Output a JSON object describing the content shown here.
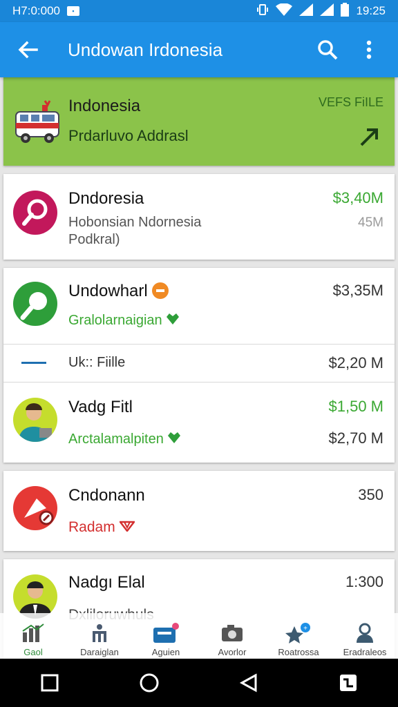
{
  "status_bar": {
    "left_text": "Н7:0:000",
    "time": "19:25",
    "badge": "▪▪"
  },
  "app_bar": {
    "title": "Undowan Irdonesia"
  },
  "banner": {
    "name": "Indonesia",
    "subtitle": "Prdarluvo Addrasl",
    "tag": "VEFS FiILE"
  },
  "items": [
    {
      "name": "Dndoresia",
      "subtitle_line1": "Hobonsian Ndornesia",
      "subtitle_line2": "Podkral)",
      "value": "$3,40M",
      "value2": "45M"
    },
    {
      "name": "Undowharl",
      "subtitle": "Gralolarnaigian",
      "value": "$3,35M"
    },
    {
      "name": "Uk:: Fiille",
      "value": "$2,20 M"
    },
    {
      "name": "Vadg Fitl",
      "subtitle": "Arctalamalpiten",
      "value": "$1,50 M",
      "value2": "$2,70 M"
    },
    {
      "name": "Cndonann",
      "subtitle": "Radam",
      "value": "350"
    },
    {
      "name": "Nadgı Elal",
      "subtitle": "Dxliloruwhuls",
      "value": "1:300"
    }
  ],
  "bottom_nav": [
    {
      "label": "Gaol"
    },
    {
      "label": "Daraiglan"
    },
    {
      "label": "Aguien"
    },
    {
      "label": "Avorlor"
    },
    {
      "label": "Roatrossa"
    },
    {
      "label": "Eradraleos"
    }
  ],
  "colors": {
    "primary": "#1e90e6",
    "status": "#1a86d8",
    "banner": "#8bc34a",
    "positive": "#3aa832",
    "negative": "#d32f2f"
  }
}
